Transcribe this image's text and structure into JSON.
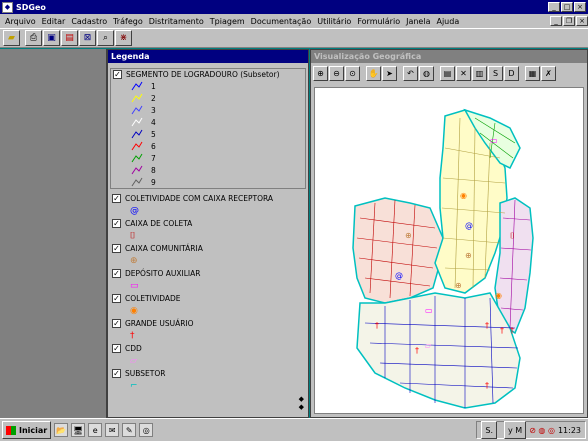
{
  "window": {
    "title": "SDGeo",
    "min": "_",
    "max": "□",
    "close": "×"
  },
  "menu": {
    "items": [
      "Arquivo",
      "Editar",
      "Cadastro",
      "Tráfego",
      "Distritamento",
      "Tpiagem",
      "Documentação",
      "Utilitário",
      "Formulário",
      "Janela",
      "Ajuda"
    ],
    "restore_min": "_",
    "restore_max": "❐",
    "restore_close": "×"
  },
  "toolbar": {
    "icons": [
      "open-icon",
      "print-icon",
      "window-icon",
      "window2-icon",
      "cross-icon",
      "zoom-icon",
      "grid-icon"
    ]
  },
  "legend": {
    "title": "Legenda",
    "segment_title": "SEGMENTO DE LOGRADOURO (Subsetor)",
    "subsetors": [
      {
        "label": "1",
        "color": "#0000ff"
      },
      {
        "label": "2",
        "color": "#ffff00"
      },
      {
        "label": "3",
        "color": "#4040ff"
      },
      {
        "label": "4",
        "color": "#ffffff"
      },
      {
        "label": "5",
        "color": "#0000c0"
      },
      {
        "label": "6",
        "color": "#ff0000"
      },
      {
        "label": "7",
        "color": "#00a000"
      },
      {
        "label": "8",
        "color": "#a000a0"
      },
      {
        "label": "9",
        "color": "#606060"
      }
    ],
    "layers": [
      {
        "label": "COLETIVIDADE COM CAIXA RECEPTORA",
        "symbol": "@",
        "color": "#0000ff"
      },
      {
        "label": "CAIXA DE COLETA",
        "symbol": "⌷",
        "color": "#c00000"
      },
      {
        "label": "CAIXA COMUNITÁRIA",
        "symbol": "⊕",
        "color": "#c08040"
      },
      {
        "label": "DEPÓSITO AUXILIAR",
        "symbol": "▭",
        "color": "#ff00ff"
      },
      {
        "label": "COLETIVIDADE",
        "symbol": "◉",
        "color": "#ff8000"
      },
      {
        "label": "GRANDE USUÁRIO",
        "symbol": "†",
        "color": "#ff0000"
      },
      {
        "label": "CDD",
        "symbol": "▱",
        "color": "#ff80ff"
      },
      {
        "label": "SUBSETOR",
        "symbol": "⌐",
        "color": "#00c0c0"
      }
    ],
    "check": "✓"
  },
  "map": {
    "title": "Visualização Geográfica",
    "tool_icons": [
      "zoom-in-icon",
      "zoom-out-icon",
      "zoom-window-icon",
      "pan-hand-icon",
      "select-arrow-icon",
      "undo-icon",
      "globe-icon",
      "legend-icon",
      "network-icon",
      "bars-icon",
      "s-icon",
      "d-icon",
      "table-icon",
      "chart-icon"
    ],
    "tool_glyphs": [
      "⊕",
      "⊖",
      "⊙",
      "✋",
      "➤",
      "↶",
      "◍",
      "▤",
      "✕",
      "▥",
      "S",
      "D",
      "▦",
      "✗"
    ]
  },
  "taskbar": {
    "start": "Iniciar",
    "quick": [
      "📂",
      "🖥",
      "e",
      "✉",
      "✎",
      "◎"
    ],
    "task1": "S.",
    "task2": "y M",
    "time": "11:23"
  }
}
